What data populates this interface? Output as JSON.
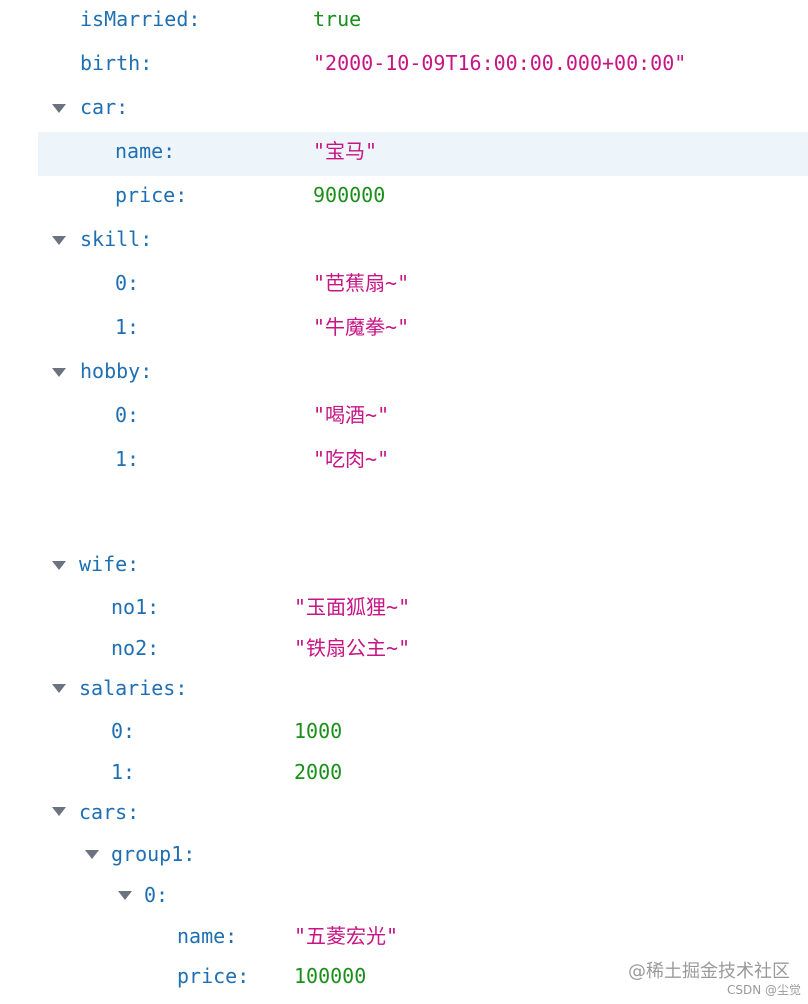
{
  "json_view": {
    "isMarried": {
      "key": "isMarried:",
      "value": "true"
    },
    "birth": {
      "key": "birth:",
      "value": "\"2000-10-09T16:00:00.000+00:00\""
    },
    "car": {
      "key": "car:",
      "name": {
        "key": "name:",
        "value": "\"宝马\""
      },
      "price": {
        "key": "price:",
        "value": "900000"
      }
    },
    "skill": {
      "key": "skill:",
      "items": [
        {
          "key": "0:",
          "value": "\"芭蕉扇~\""
        },
        {
          "key": "1:",
          "value": "\"牛魔拳~\""
        }
      ]
    },
    "hobby": {
      "key": "hobby:",
      "items": [
        {
          "key": "0:",
          "value": "\"喝酒~\""
        },
        {
          "key": "1:",
          "value": "\"吃肉~\""
        }
      ]
    },
    "wife": {
      "key": "wife:",
      "no1": {
        "key": "no1:",
        "value": "\"玉面狐狸~\""
      },
      "no2": {
        "key": "no2:",
        "value": "\"铁扇公主~\""
      }
    },
    "salaries": {
      "key": "salaries:",
      "items": [
        {
          "key": "0:",
          "value": "1000"
        },
        {
          "key": "1:",
          "value": "2000"
        }
      ]
    },
    "cars": {
      "key": "cars:",
      "group1": {
        "key": "group1:",
        "item0": {
          "key": "0:",
          "name": {
            "key": "name:",
            "value": "\"五菱宏光\""
          },
          "price": {
            "key": "price:",
            "value": "100000"
          }
        }
      }
    }
  },
  "watermark": {
    "site": "@稀土掘金技术社区",
    "source": "CSDN @尘觉"
  },
  "colors": {
    "key": "#1f6fb2",
    "string": "#c71585",
    "number": "#1a8f1a",
    "boolean": "#1a8f1a",
    "arrow": "#6b7280",
    "highlight": "#eef5fa"
  }
}
